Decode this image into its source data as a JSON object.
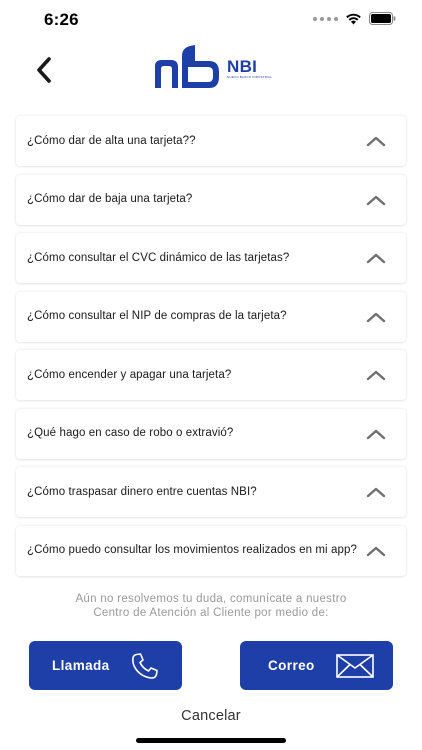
{
  "status_bar": {
    "time": "6:26"
  },
  "header": {
    "logo_brand": "NBI",
    "logo_subtext": "NUEVO BANCO INDUSTRIAL"
  },
  "faq": {
    "items": [
      {
        "question": "¿Cómo dar de alta una tarjeta??"
      },
      {
        "question": "¿Cómo dar de baja una tarjeta?"
      },
      {
        "question": "¿Cómo consultar el CVC dinámico de las tarjetas?"
      },
      {
        "question": "¿Cómo consultar el NIP de compras de la tarjeta?"
      },
      {
        "question": "¿Cómo encender y apagar una tarjeta?"
      },
      {
        "question": "¿Qué hago en caso de robo o extravió?"
      },
      {
        "question": "¿Cómo traspasar dinero entre cuentas NBI?"
      },
      {
        "question": "¿Cómo puedo consultar los movimientos realizados en mi app?"
      }
    ]
  },
  "help": {
    "line1": "Aún no resolvemos tu duda, comunícate a nuestro",
    "line2": "Centro de Atención al Cliente por medio de:"
  },
  "contact": {
    "call_label": "Llamada",
    "mail_label": "Correo"
  },
  "cancel_label": "Cancelar",
  "colors": {
    "brand_blue": "#1f3fa8",
    "help_text": "#999999",
    "chevron": "#707070"
  },
  "icons": {
    "back": "chevron-left-icon",
    "faq_toggle": "chevron-up-icon",
    "call": "phone-icon",
    "mail": "envelope-icon"
  }
}
